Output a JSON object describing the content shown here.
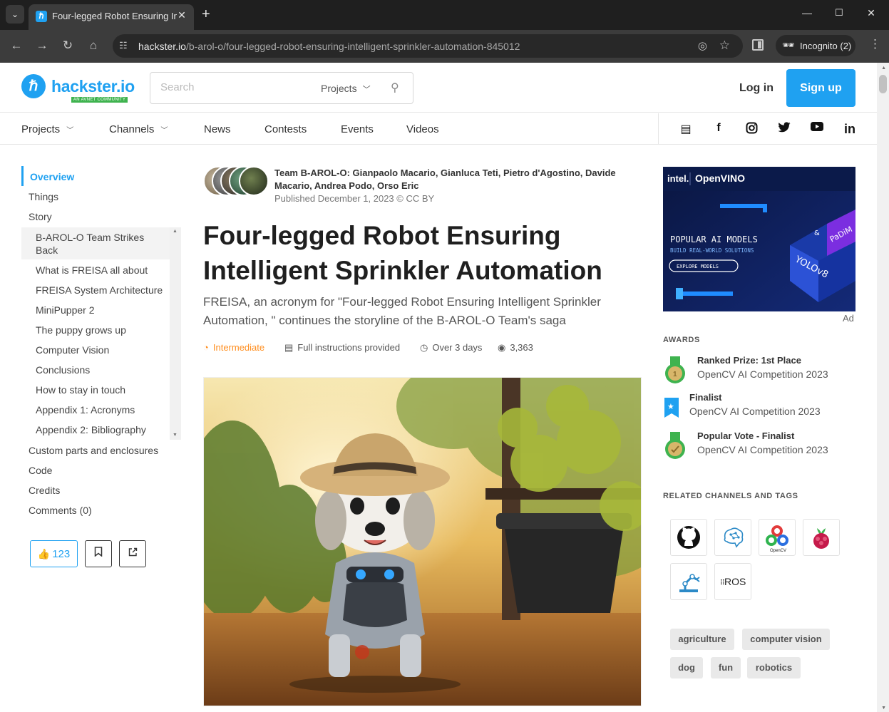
{
  "browser": {
    "tab_title": "Four-legged Robot Ensuring Intelligent Sprinkler Automation - Hackster.io",
    "tab_close": "✕",
    "new_tab": "+",
    "url_host": "hackster.io",
    "url_path": "/b-arol-o/four-legged-robot-ensuring-intelligent-sprinkler-automation-845012",
    "incognito_label": "Incognito (2)"
  },
  "header": {
    "logo_text": "hackster.io",
    "logo_sub": "AN AVNET COMMUNITY",
    "search_placeholder": "Search",
    "search_scope": "Projects",
    "login": "Log in",
    "signup": "Sign up"
  },
  "nav": {
    "items": [
      "Projects",
      "Channels",
      "News",
      "Contests",
      "Events",
      "Videos"
    ],
    "social": [
      "rss-icon",
      "facebook-icon",
      "instagram-icon",
      "twitter-icon",
      "youtube-icon",
      "linkedin-icon"
    ]
  },
  "toc": {
    "top": [
      "Overview",
      "Things",
      "Story"
    ],
    "story_sub": [
      "B-AROL-O Team Strikes",
      "Back",
      "What is FREISA all about",
      "FREISA System Architecture",
      "MiniPupper 2",
      "The puppy grows up",
      "Computer Vision",
      "Conclusions",
      "How to stay in touch",
      "Appendix 1: Acronyms",
      "Appendix 2: Bibliography"
    ],
    "bottom": [
      "Custom parts and enclosures",
      "Code",
      "Credits",
      "Comments (0)"
    ]
  },
  "actions": {
    "respect_count": "123"
  },
  "article": {
    "authors": "Team B-AROL-O: Gianpaolo Macario, Gianluca Teti, Pietro d'Agostino, Davide Macario, Andrea Podo, Orso Eric",
    "published": "Published December 1, 2023 © CC BY",
    "title": "Four-legged Robot Ensuring Intelligent Sprinkler Automation",
    "subtitle": "FREISA, an acronym for \"Four-legged Robot Ensuring Intelligent Sprinkler Automation, \" continues the storyline of the B-AROL-O Team's saga",
    "difficulty": "Intermediate",
    "instructions": "Full instructions provided",
    "duration": "Over 3 days",
    "views": "3,363"
  },
  "ad": {
    "brand": "intel.",
    "product": "OpenVINO",
    "headline": "POPULAR AI MODELS",
    "tagline": "BUILD REAL-WORLD SOLUTIONS",
    "cta": "EXPLORE MODELS",
    "cube_text_1": "YOLOv8",
    "cube_text_2": "PaDiM",
    "cube_text_3": "&",
    "label": "Ad"
  },
  "awards": {
    "title": "AWARDS",
    "items": [
      {
        "name": "Ranked Prize: 1st Place",
        "sub": "OpenCV AI Competition 2023"
      },
      {
        "name": "Finalist",
        "sub": "OpenCV AI Competition 2023"
      },
      {
        "name": "Popular Vote - Finalist",
        "sub": "OpenCV AI Competition 2023"
      }
    ]
  },
  "channels": {
    "title": "RELATED CHANNELS AND TAGS",
    "items": [
      "github-icon",
      "neural-brain-icon",
      "opencv-icon",
      "raspberry-pi-icon",
      "robot-arm-icon",
      "ros-icon"
    ],
    "ros_label": "ROS",
    "opencv_label": "OpenCV",
    "tags": [
      "agriculture",
      "computer vision",
      "dog",
      "fun",
      "robotics"
    ]
  },
  "colors": {
    "brand": "#1fa1f1",
    "award_green": "#3fb34f",
    "difficulty": "#ff8e1f"
  }
}
